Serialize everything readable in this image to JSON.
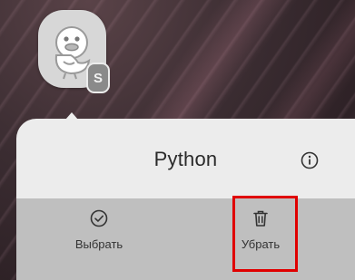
{
  "app": {
    "icon_name": "duck-app-icon",
    "badge_letter": "S",
    "title": "Python"
  },
  "header": {
    "info_icon": "info-icon"
  },
  "actions": [
    {
      "label": "Выбрать",
      "icon": "check-circle-icon"
    },
    {
      "label": "Убрать",
      "icon": "trash-icon"
    }
  ],
  "colors": {
    "popup_bg": "#ececec",
    "actions_bg": "#bfbfbf",
    "highlight": "#e00000",
    "wallpaper": "#3a2c31"
  }
}
